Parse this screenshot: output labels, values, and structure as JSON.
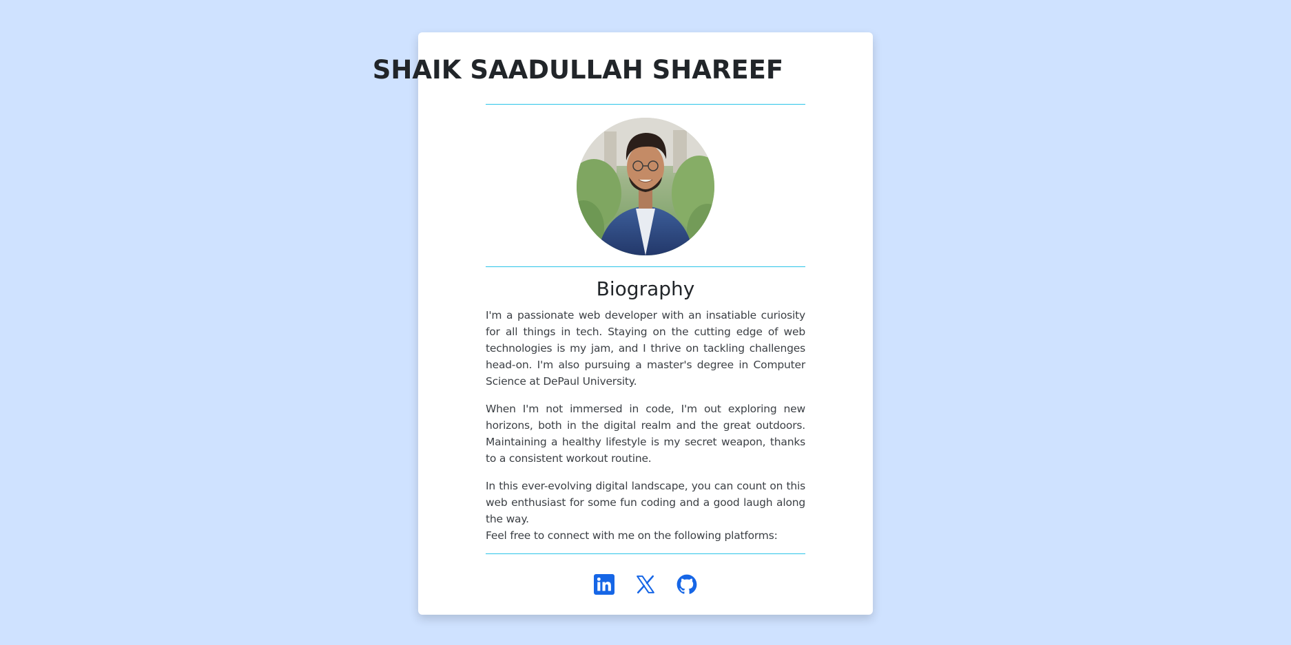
{
  "profile": {
    "name": "SHAIK SAADULLAH SHAREEF",
    "photo_alt": "avatar"
  },
  "biography": {
    "heading": "Biography",
    "paragraphs": [
      "I'm a passionate web developer with an insatiable curiosity for all things in tech. Staying on the cutting edge of web technologies is my jam, and I thrive on tackling challenges head-on. I'm also pursuing a master's degree in Computer Science at DePaul University.",
      "When I'm not immersed in code, I'm out exploring new horizons, both in the digital realm and the great outdoors. Maintaining a healthy lifestyle is my secret weapon, thanks to a consistent workout routine.",
      "In this ever-evolving digital landscape, you can count on this web enthusiast for some fun coding and a good laugh along the way."
    ],
    "connect_text": "Feel free to connect with me on the following platforms:"
  },
  "social": {
    "items": [
      {
        "icon": "linkedin-icon"
      },
      {
        "icon": "x-icon"
      },
      {
        "icon": "github-icon"
      }
    ]
  },
  "colors": {
    "page_background": "#cfe2ff",
    "card_background": "#ffffff",
    "divider": "#29c3e8",
    "icon": "#1666e6",
    "title_text": "#212529"
  }
}
